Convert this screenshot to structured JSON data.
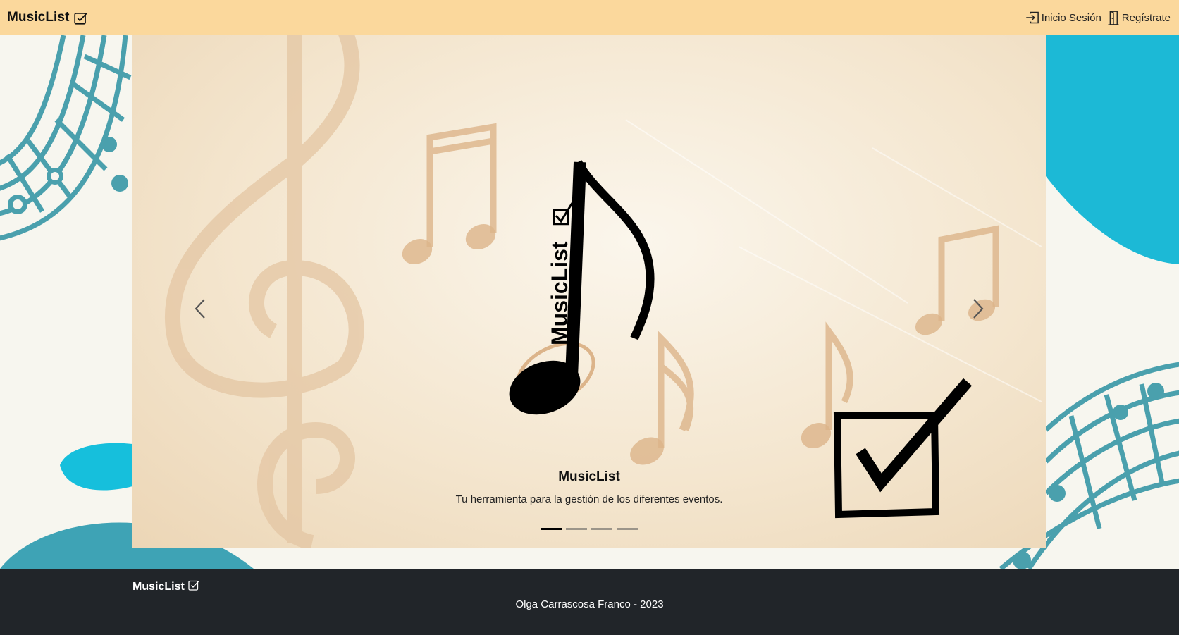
{
  "navbar": {
    "brand": "MusicList",
    "links": {
      "login": "Inicio Sesión",
      "register": "Regístrate"
    }
  },
  "carousel": {
    "logo_text": "MusicList",
    "caption_title": "MusicList",
    "caption_text": "Tu herramienta para la gestión de los diferentes eventos.",
    "slides": 4,
    "active_slide": 1
  },
  "footer": {
    "brand": "MusicList",
    "copyright": "Olga Carrascosa Franco - 2023"
  },
  "colors": {
    "navbar_bg": "#fbd89c",
    "page_bg": "#f7f6ef",
    "teal": "#4aa0ad",
    "cyan": "#16bfdc",
    "footer_bg": "#212529",
    "note_beige": "#dcb48a"
  },
  "icons": {
    "brand": "check-square-icon",
    "login": "box-arrow-in-right-icon",
    "register": "door-open-icon",
    "prev": "chevron-left-icon",
    "next": "chevron-right-icon"
  }
}
